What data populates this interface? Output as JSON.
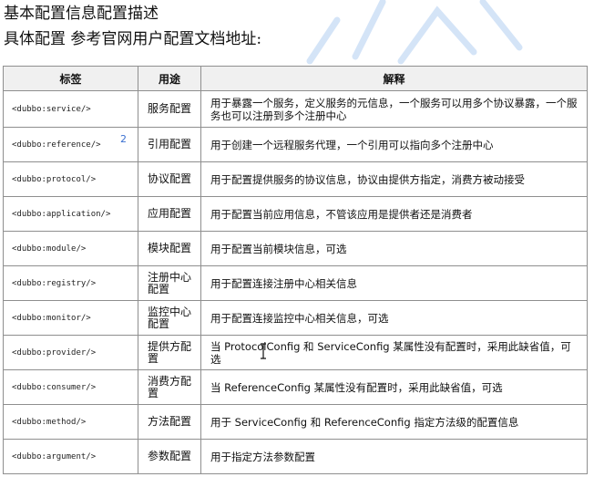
{
  "heading1": "基本配置信息配置描述",
  "heading2": "具体配置  参考官网用户配置文档地址:",
  "table": {
    "headers": [
      "标签",
      "用途",
      "解释"
    ],
    "rows": [
      {
        "tag": "<dubbo:service/>",
        "use": "服务配置",
        "desc": "用于暴露一个服务，定义服务的元信息，一个服务可以用多个协议暴露，一个服务也可以注册到多个注册中心"
      },
      {
        "tag": "<dubbo:reference/>",
        "note": "2",
        "use": "引用配置",
        "desc": "用于创建一个远程服务代理，一个引用可以指向多个注册中心"
      },
      {
        "tag": "<dubbo:protocol/>",
        "use": "协议配置",
        "desc": "用于配置提供服务的协议信息，协议由提供方指定，消费方被动接受"
      },
      {
        "tag": "<dubbo:application/>",
        "use": "应用配置",
        "desc": "用于配置当前应用信息，不管该应用是提供者还是消费者"
      },
      {
        "tag": "<dubbo:module/>",
        "use": "模块配置",
        "desc": "用于配置当前模块信息，可选"
      },
      {
        "tag": "<dubbo:registry/>",
        "use": "注册中心配置",
        "desc": "用于配置连接注册中心相关信息"
      },
      {
        "tag": "<dubbo:monitor/>",
        "use": "监控中心配置",
        "desc": "用于配置连接监控中心相关信息，可选"
      },
      {
        "tag": "<dubbo:provider/>",
        "use": "提供方配置",
        "desc": "当 ProtocolConfig 和 ServiceConfig 某属性没有配置时，采用此缺省值，可选"
      },
      {
        "tag": "<dubbo:consumer/>",
        "use": "消费方配置",
        "desc": "当 ReferenceConfig 某属性没有配置时，采用此缺省值，可选"
      },
      {
        "tag": "<dubbo:method/>",
        "use": "方法配置",
        "desc": "用于 ServiceConfig 和 ReferenceConfig 指定方法级的配置信息"
      },
      {
        "tag": "<dubbo:argument/>",
        "use": "参数配置",
        "desc": "用于指定方法参数配置"
      }
    ]
  },
  "icons": {
    "cursor": "text-cursor-icon",
    "watermark": "watermark-logo"
  }
}
